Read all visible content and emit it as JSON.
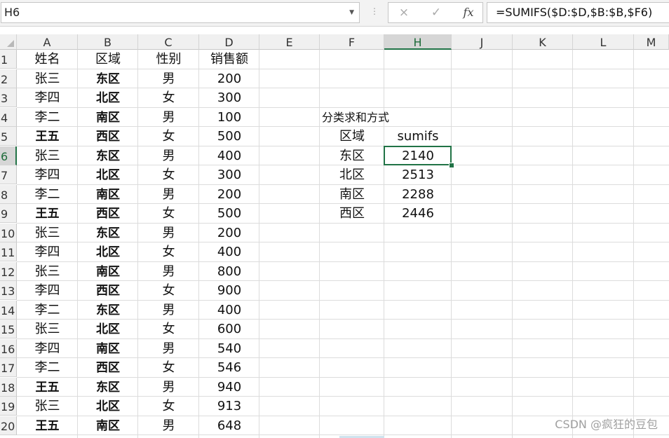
{
  "formula_bar": {
    "name_box": "H6",
    "separator": "⋮",
    "cancel_icon": "×",
    "enter_icon": "✓",
    "fx_label": "fx",
    "formula": "=SUMIFS($D:$D,$B:$B,$F6)"
  },
  "columns": [
    "A",
    "B",
    "C",
    "D",
    "E",
    "F",
    "H",
    "J",
    "K",
    "L",
    "M"
  ],
  "selected_column": "H",
  "rows": [
    "1",
    "2",
    "3",
    "4",
    "5",
    "6",
    "7",
    "8",
    "9",
    "10",
    "11",
    "12",
    "13",
    "14",
    "15",
    "16",
    "17",
    "18",
    "19",
    "20"
  ],
  "selected_row": "6",
  "table": {
    "headers": [
      "姓名",
      "区域",
      "性别",
      "销售额"
    ],
    "rows": [
      [
        "张三",
        "东区",
        "男",
        "200"
      ],
      [
        "李四",
        "北区",
        "女",
        "300"
      ],
      [
        "李二",
        "南区",
        "男",
        "100"
      ],
      [
        "王五",
        "西区",
        "女",
        "500"
      ],
      [
        "张三",
        "东区",
        "男",
        "400"
      ],
      [
        "李四",
        "北区",
        "女",
        "300"
      ],
      [
        "李二",
        "南区",
        "男",
        "200"
      ],
      [
        "王五",
        "西区",
        "女",
        "500"
      ],
      [
        "张三",
        "东区",
        "男",
        "200"
      ],
      [
        "李四",
        "北区",
        "女",
        "400"
      ],
      [
        "张三",
        "南区",
        "男",
        "800"
      ],
      [
        "李四",
        "西区",
        "女",
        "900"
      ],
      [
        "李二",
        "东区",
        "男",
        "400"
      ],
      [
        "张三",
        "北区",
        "女",
        "600"
      ],
      [
        "李四",
        "南区",
        "男",
        "540"
      ],
      [
        "李二",
        "西区",
        "女",
        "546"
      ],
      [
        "王五",
        "东区",
        "男",
        "940"
      ],
      [
        "张三",
        "北区",
        "女",
        "913"
      ],
      [
        "王五",
        "南区",
        "男",
        "648"
      ]
    ]
  },
  "summary": {
    "title": "分类求和方式",
    "header_region": "区域",
    "header_value": "sumifs",
    "rows": [
      [
        "东区",
        "2140"
      ],
      [
        "北区",
        "2513"
      ],
      [
        "南区",
        "2288"
      ],
      [
        "西区",
        "2446"
      ]
    ]
  },
  "watermark": "CSDN @疯狂的豆包",
  "colors": {
    "selection": "#217346",
    "header_bg": "#f0f0f0"
  }
}
